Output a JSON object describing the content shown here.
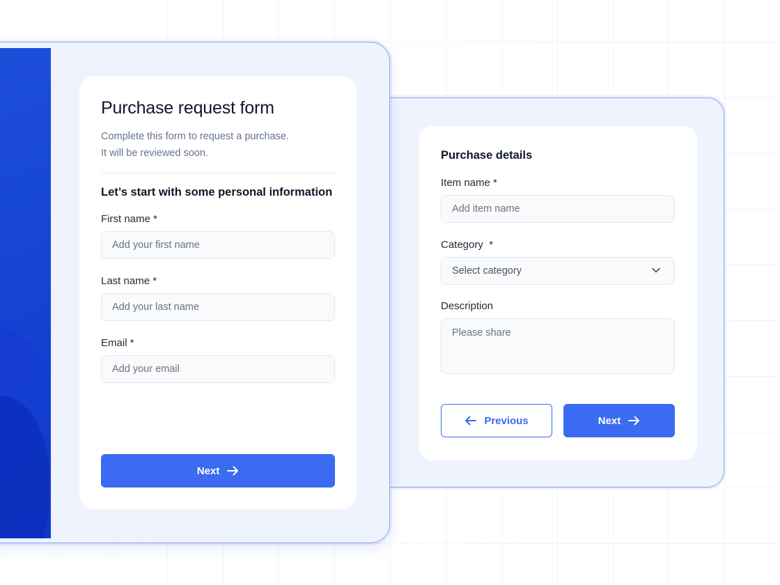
{
  "colors": {
    "accent": "#3b6bf0",
    "window_bg": "#eef3fd",
    "window_border": "#8ea6f0",
    "blue_panel": "#1d4ed8"
  },
  "front_form": {
    "title": "Purchase request form",
    "subtitle_line1": "Complete this form to request a purchase.",
    "subtitle_line2": "It will be reviewed soon.",
    "section_heading": "Let’s start with some personal information",
    "first_name": {
      "label": "First name *",
      "placeholder": "Add your first name",
      "value": ""
    },
    "last_name": {
      "label": "Last name *",
      "placeholder": "Add your last name",
      "value": ""
    },
    "email": {
      "label": "Email *",
      "placeholder": "Add your email",
      "value": ""
    },
    "next_label": "Next",
    "next_icon": "arrow-right-icon"
  },
  "back_form": {
    "section_heading": "Purchase details",
    "item_name": {
      "label": "Item name *",
      "placeholder": "Add item name",
      "value": ""
    },
    "category": {
      "label": "Category  *",
      "selected": "Select category",
      "icon": "chevron-down-icon"
    },
    "description": {
      "label": "Description",
      "placeholder": "Please share",
      "value": ""
    },
    "previous_label": "Previous",
    "previous_icon": "arrow-left-icon",
    "next_label": "Next",
    "next_icon": "arrow-right-icon"
  }
}
